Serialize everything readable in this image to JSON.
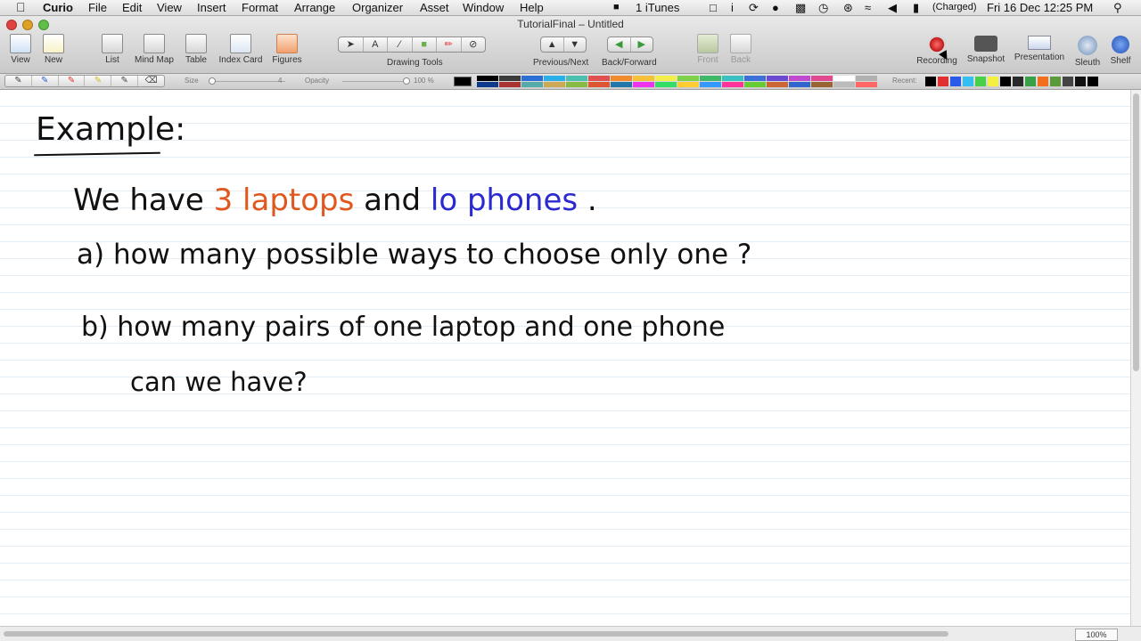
{
  "menubar": {
    "app": "Curio",
    "items": [
      "File",
      "Edit",
      "View",
      "Insert",
      "Format",
      "Arrange",
      "Organizer",
      "Asset",
      "Window",
      "Help"
    ],
    "status": {
      "itunes": "1  iTunes",
      "battery": "(Charged)",
      "clock": "Fri 16 Dec  12:25 PM"
    }
  },
  "window": {
    "title": "TutorialFinal – Untitled"
  },
  "toolbar": {
    "view": "View",
    "new": "New",
    "list": "List",
    "mind_map": "Mind Map",
    "table": "Table",
    "index_card": "Index Card",
    "figures": "Figures",
    "drawing_tools": "Drawing Tools",
    "previous_next": "Previous/Next",
    "back_forward": "Back/Forward",
    "front": "Front",
    "back": "Back",
    "recording": "Recording",
    "snapshot": "Snapshot",
    "presentation": "Presentation",
    "sleuth": "Sleuth",
    "shelf": "Shelf"
  },
  "drawbar": {
    "size_label": "Size",
    "size_value": "4",
    "opacity_label": "Opacity",
    "opacity_value": "100 %",
    "recent_label": "Recent:"
  },
  "colors": {
    "palette": [
      "#000000",
      "#3a3a3a",
      "#2b6fd6",
      "#2ab0e6",
      "#49c0b0",
      "#e05050",
      "#f08a2c",
      "#f6c13a",
      "#f2ee4a",
      "#7fd14a",
      "#40b86a",
      "#3ac0c0",
      "#3a70d8",
      "#6a4ad0",
      "#c04ad0",
      "#e04a90",
      "#ffffff",
      "#b0b0b0",
      "#0d3b8a",
      "#a33",
      "#5aa",
      "#ca5",
      "#8b4",
      "#d53",
      "#27a",
      "#e3e",
      "#3d6",
      "#fc3",
      "#39f",
      "#f39",
      "#6c3",
      "#c63",
      "#36c",
      "#963",
      "#bbb",
      "#f66"
    ],
    "recent": [
      "#000000",
      "#e03030",
      "#2a5ae8",
      "#33c0f0",
      "#48d048",
      "#f4f040",
      "#000000",
      "#2a2a2a",
      "#3aa048",
      "#f07020",
      "#5a9a3a",
      "#444444",
      "#111111",
      "#000000"
    ]
  },
  "note": {
    "title": "Example:",
    "line1": {
      "prefix": "We  have  ",
      "laptops": "3  laptops",
      "mid": "   and  ",
      "phones": "lo  phones",
      "suffix": " ."
    },
    "qa": "a) how  many  possible  ways  to  choose  only  one ?",
    "qb1": "b) how  many  pairs  of  one  laptop  and  one  phone",
    "qb2": "can  we  have?"
  },
  "status": {
    "zoom": "100%"
  }
}
